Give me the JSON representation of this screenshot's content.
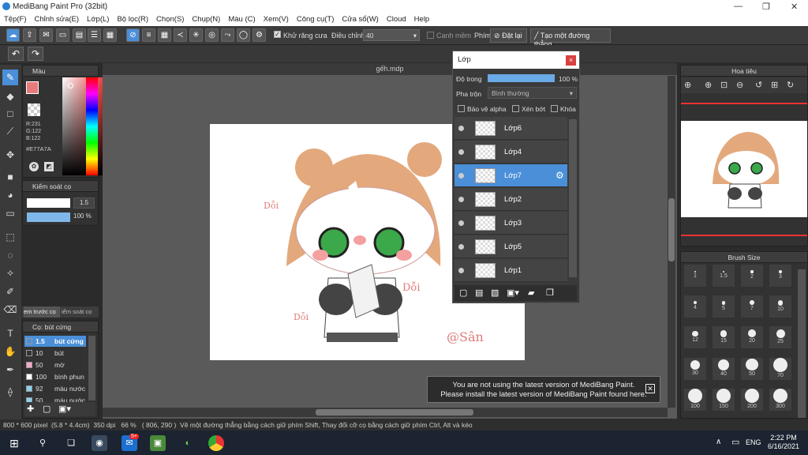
{
  "window": {
    "title": "MediBang Paint Pro (32bit)"
  },
  "menu": [
    "Tệp(F)",
    "Chỉnh sửa(E)",
    "Lớp(L)",
    "Bộ lọc(R)",
    "Chọn(S)",
    "Chụp(N)",
    "Màu (C)",
    "Xem(V)",
    "Công cụ(T)",
    "Cửa sổ(W)",
    "Cloud",
    "Help"
  ],
  "toolbar": {
    "antialias": "Khử răng cưa",
    "adjust_label": "Điều chỉnh",
    "adjust_value": "40",
    "edge": "Canh mềm",
    "key_label": "Phím",
    "reset": "Đặt lại",
    "line": "Tạo một đường thẳng"
  },
  "color_panel": {
    "title": "Màu",
    "r": "R:231",
    "g": "G:122",
    "b": "B:122",
    "hex": "#E77A7A",
    "accent": "#E77A7A"
  },
  "brush_ctrl": {
    "title": "Kiểm soát cọ",
    "size": "1.5",
    "opacity": "100 %"
  },
  "tabs": {
    "preview": "em trước cọ",
    "control": "iểm soát cọ"
  },
  "brush_list": {
    "title": "Cọ: bút cứng",
    "items": [
      {
        "size": "1.5",
        "name": "bút cứng"
      },
      {
        "size": "10",
        "name": "bút"
      },
      {
        "size": "50",
        "name": "mờ"
      },
      {
        "size": "100",
        "name": "bình phun"
      },
      {
        "size": "92",
        "name": "màu nước"
      },
      {
        "size": "50",
        "name": "màu nước"
      }
    ]
  },
  "document": {
    "tab": "gếh.mdp",
    "sign1": "Dỗi",
    "sign2": "Dỗi",
    "sign3": "Dỗi",
    "watermark": "@Sân"
  },
  "layers": {
    "title": "Lớp",
    "opacity_label": "Độ trong",
    "opacity_value": "100 %",
    "blend_label": "Pha trộn",
    "blend_value": "Bình thường",
    "protect_alpha": "Bảo vệ alpha",
    "clip": "Xén bớt",
    "lock": "Khóa",
    "items": [
      "Lớp6",
      "Lớp4",
      "Lớp7",
      "Lớp2",
      "Lớp3",
      "Lớp5",
      "Lớp1"
    ],
    "selected": "Lớp7"
  },
  "navigator": {
    "title": "Hoa tiêu"
  },
  "brush_size": {
    "title": "Brush Size",
    "sizes": [
      "1",
      "1.5",
      "2",
      "3",
      "4",
      "5",
      "7",
      "10",
      "12",
      "15",
      "20",
      "25",
      "30",
      "40",
      "50",
      "70",
      "100",
      "150",
      "200",
      "300"
    ]
  },
  "notification": {
    "line1": "You are not using the latest version of MediBang Paint.",
    "line2": "Please install the latest version of MediBang Paint found here."
  },
  "status": {
    "dims": "800 * 600 pixel",
    "cm": "(5.8 * 4.4cm)",
    "dpi": "350 dpi",
    "zoom": "66 %",
    "coords": "( 806, 290 )",
    "hint": "Vẽ một đường thẳng bằng cách giữ phím Shift, Thay đổi cỡ cọ bằng cách giữ phím Ctrl, Alt và kéo"
  },
  "taskbar": {
    "lang": "ENG",
    "time": "2:22 PM",
    "date": "6/16/2021",
    "badge": "5+"
  }
}
